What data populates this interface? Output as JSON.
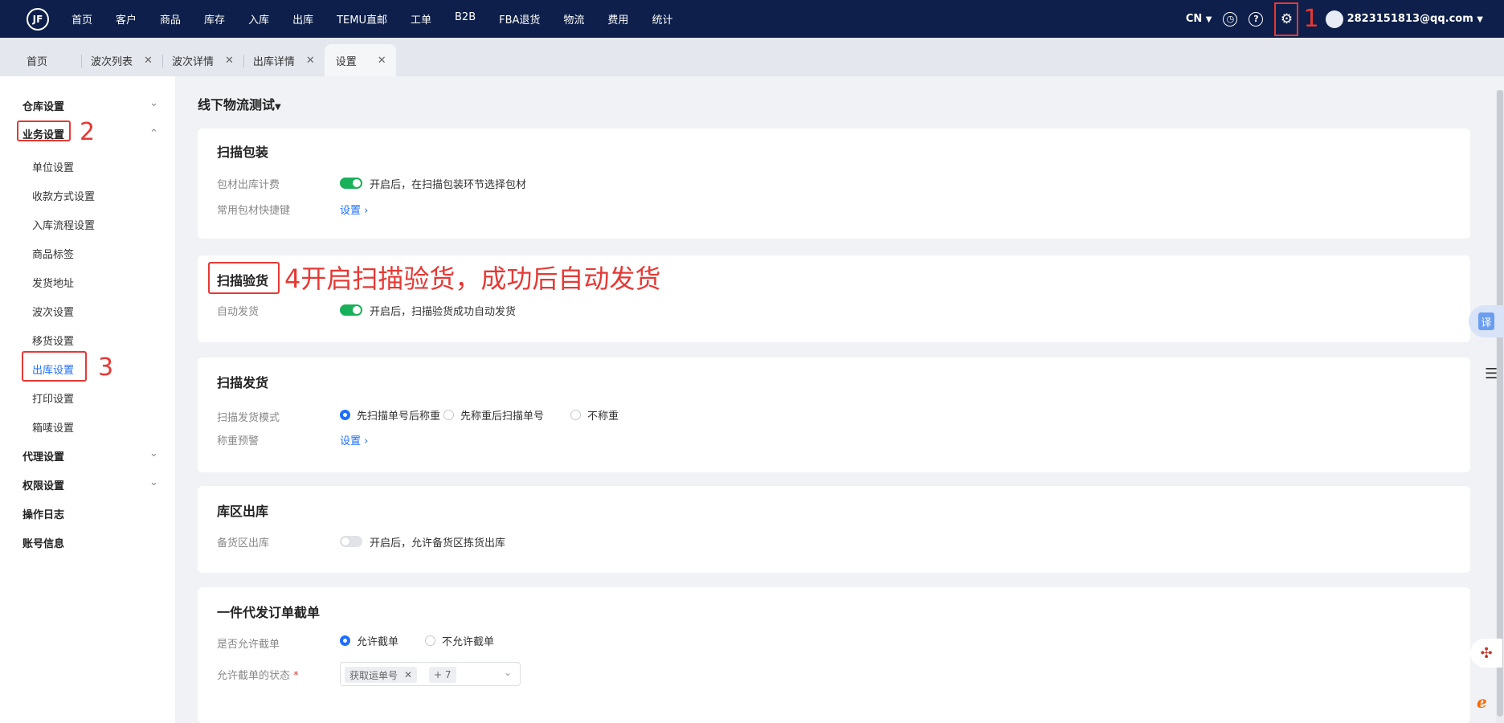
{
  "topbar": {
    "logo_text": "JF",
    "nav": [
      "首页",
      "客户",
      "商品",
      "库存",
      "入库",
      "出库",
      "TEMU直邮",
      "工单",
      "B2B",
      "FBA退货",
      "物流",
      "费用",
      "统计"
    ],
    "lang": "CN",
    "user_email": "2823151813@qq.com",
    "annotation_1": "1"
  },
  "tabs": [
    {
      "label": "首页"
    },
    {
      "label": "波次列表"
    },
    {
      "label": "波次详情"
    },
    {
      "label": "出库详情"
    },
    {
      "label": "设置"
    }
  ],
  "sidebar": {
    "groups": {
      "warehouse": "仓库设置",
      "business": "业务设置",
      "agent": "代理设置",
      "permission": "权限设置",
      "oplog": "操作日志",
      "account": "账号信息"
    },
    "items": [
      "单位设置",
      "收款方式设置",
      "入库流程设置",
      "商品标签",
      "发货地址",
      "波次设置",
      "移货设置",
      "出库设置",
      "打印设置",
      "箱唛设置"
    ],
    "annotation_2": "2",
    "annotation_3": "3"
  },
  "main": {
    "warehouse_selector": "线下物流测试",
    "cards": {
      "scan_pack": {
        "title": "扫描包装",
        "row1_label": "包材出库计费",
        "row1_toggle_on": true,
        "row1_text": "开启后，在扫描包装环节选择包材",
        "row2_label": "常用包材快捷键",
        "row2_link": "设置"
      },
      "scan_check": {
        "title": "扫描验货",
        "annotation": "4开启扫描验货，成功后自动发货",
        "row1_label": "自动发货",
        "row1_toggle_on": true,
        "row1_text": "开启后，扫描验货成功自动发货"
      },
      "scan_ship": {
        "title": "扫描发货",
        "row1_label": "扫描发货模式",
        "options": [
          "先扫描单号后称重",
          "先称重后扫描单号",
          "不称重"
        ],
        "selected": "先扫描单号后称重",
        "row2_label": "称重预警",
        "row2_link": "设置"
      },
      "zone_out": {
        "title": "库区出库",
        "row1_label": "备货区出库",
        "row1_toggle_on": false,
        "row1_text": "开启后，允许备货区拣货出库"
      },
      "dropship": {
        "title": "一件代发订单截单",
        "row1_label": "是否允许截单",
        "options": [
          "允许截单",
          "不允许截单"
        ],
        "selected": "允许截单",
        "row2_label": "允许截单的状态",
        "row2_required": "*",
        "tag": "获取运单号",
        "more": "+ 7"
      }
    }
  },
  "float": {
    "translate": "译"
  }
}
